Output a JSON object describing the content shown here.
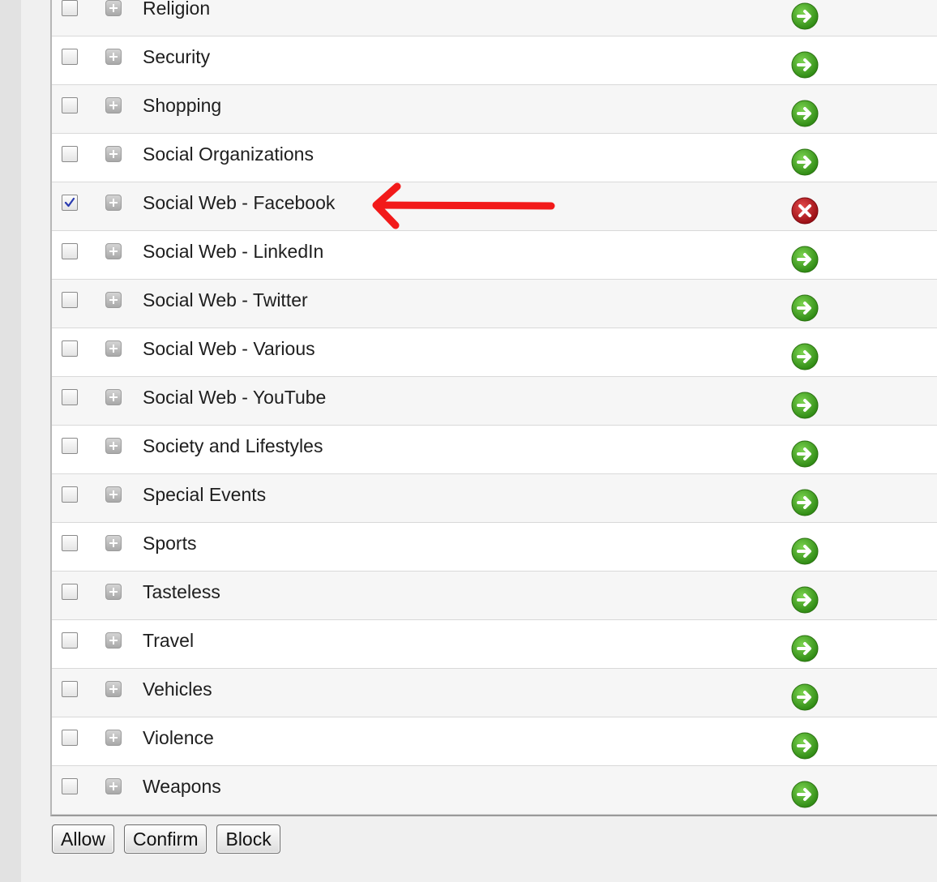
{
  "categories": [
    {
      "label": "Religion",
      "checked": false,
      "action": "allow-icon"
    },
    {
      "label": "Security",
      "checked": false,
      "action": "allow-icon"
    },
    {
      "label": "Shopping",
      "checked": false,
      "action": "allow-icon"
    },
    {
      "label": "Social Organizations",
      "checked": false,
      "action": "allow-icon"
    },
    {
      "label": "Social Web - Facebook",
      "checked": true,
      "action": "block-icon"
    },
    {
      "label": "Social Web - LinkedIn",
      "checked": false,
      "action": "allow-icon"
    },
    {
      "label": "Social Web - Twitter",
      "checked": false,
      "action": "allow-icon"
    },
    {
      "label": "Social Web - Various",
      "checked": false,
      "action": "allow-icon"
    },
    {
      "label": "Social Web - YouTube",
      "checked": false,
      "action": "allow-icon"
    },
    {
      "label": "Society and Lifestyles",
      "checked": false,
      "action": "allow-icon"
    },
    {
      "label": "Special Events",
      "checked": false,
      "action": "allow-icon"
    },
    {
      "label": "Sports",
      "checked": false,
      "action": "allow-icon"
    },
    {
      "label": "Tasteless",
      "checked": false,
      "action": "allow-icon"
    },
    {
      "label": "Travel",
      "checked": false,
      "action": "allow-icon"
    },
    {
      "label": "Vehicles",
      "checked": false,
      "action": "allow-icon"
    },
    {
      "label": "Violence",
      "checked": false,
      "action": "allow-icon"
    },
    {
      "label": "Weapons",
      "checked": false,
      "action": "allow-icon"
    }
  ],
  "buttons": {
    "allow_label": "Allow",
    "confirm_label": "Confirm",
    "block_label": "Block"
  },
  "colors": {
    "allow_green": "#3a9a1c",
    "block_red": "#b0121b",
    "annotation_red": "#f21a1a"
  },
  "annotation": {
    "icon": "red-arrow-icon",
    "points_to": "Social Web - Facebook"
  }
}
